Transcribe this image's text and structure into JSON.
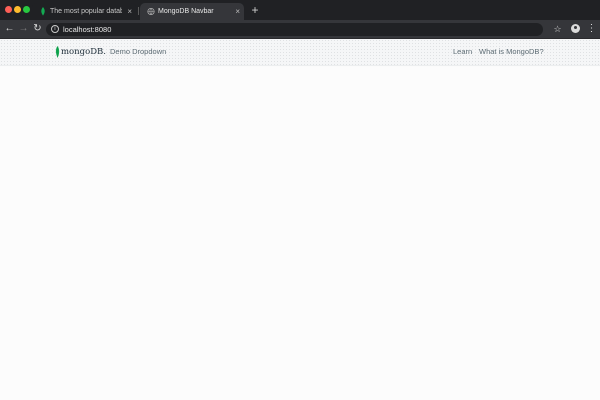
{
  "browser": {
    "tabs": [
      {
        "title": "The most popular database for",
        "active": false
      },
      {
        "title": "MongoDB Navbar",
        "active": true
      }
    ],
    "new_tab_symbol": "+",
    "close_symbol": "×",
    "address_bar": {
      "url": "localhost:8080"
    }
  },
  "site": {
    "brand": "mongoDB.",
    "nav_left": [
      "Demo Dropdown"
    ],
    "nav_right": [
      "Learn",
      "What is MongoDB?"
    ]
  },
  "colors": {
    "chrome_dark": "#202124",
    "chrome_toolbar": "#35363a",
    "mongodb_green": "#13aa52",
    "brand_text": "#21313c",
    "nav_link": "#5d6c74"
  },
  "icons": {
    "back": "back-arrow-icon",
    "forward": "forward-arrow-icon",
    "reload": "reload-icon",
    "info": "info-icon",
    "star": "star-icon",
    "account": "account-icon",
    "menu": "kebab-menu-icon"
  }
}
